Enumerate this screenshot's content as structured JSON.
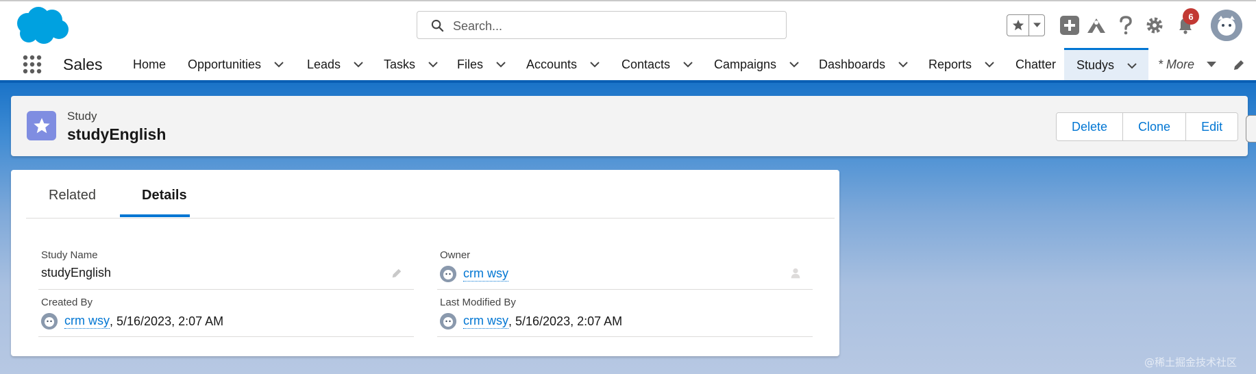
{
  "header": {
    "search_placeholder": "Search...",
    "notification_count": "6"
  },
  "nav": {
    "app_name": "Sales",
    "items": [
      {
        "label": "Home"
      },
      {
        "label": "Opportunities"
      },
      {
        "label": "Leads"
      },
      {
        "label": "Tasks"
      },
      {
        "label": "Files"
      },
      {
        "label": "Accounts"
      },
      {
        "label": "Contacts"
      },
      {
        "label": "Campaigns"
      },
      {
        "label": "Dashboards"
      },
      {
        "label": "Reports"
      },
      {
        "label": "Chatter"
      },
      {
        "label": "Studys"
      }
    ],
    "more_label": "* More"
  },
  "record": {
    "type": "Study",
    "title": "studyEnglish",
    "actions": [
      "Delete",
      "Clone",
      "Edit"
    ]
  },
  "tabs": [
    "Related",
    "Details"
  ],
  "details": {
    "study_name_label": "Study Name",
    "study_name_value": "studyEnglish",
    "owner_label": "Owner",
    "owner_value": "crm wsy",
    "created_by_label": "Created By",
    "created_by_user": "crm wsy",
    "created_by_date": ", 5/16/2023, 2:07 AM",
    "modified_by_label": "Last Modified By",
    "modified_by_user": "crm wsy",
    "modified_by_date": ", 5/16/2023, 2:07 AM"
  },
  "watermark": "@稀土掘金技术社区",
  "colors": {
    "brand_blue": "#0176d3",
    "record_icon": "#7f8de1",
    "badge_red": "#c23934"
  }
}
